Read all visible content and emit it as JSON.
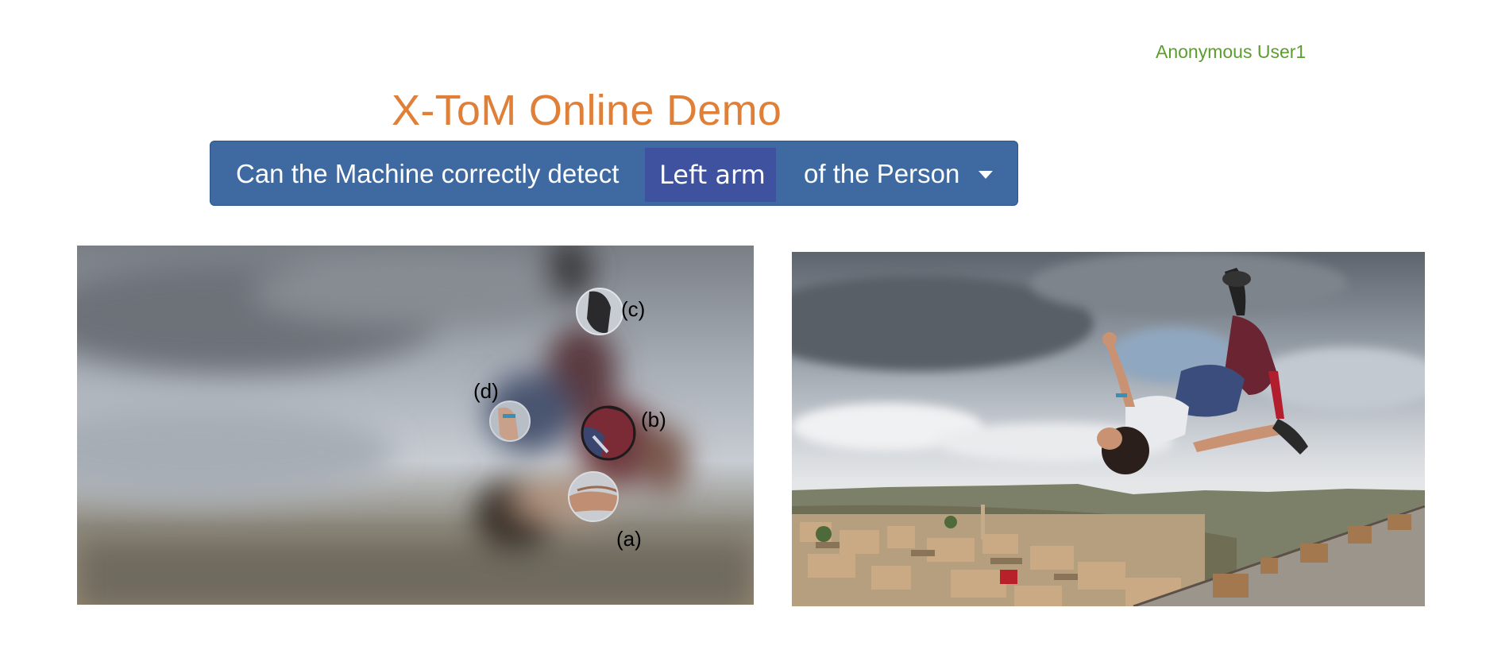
{
  "header": {
    "user_name": "Anonymous User1",
    "title": "X-ToM Online Demo"
  },
  "question": {
    "prefix": "Can the Machine correctly detect",
    "selected_part": "Left arm",
    "suffix": "of the Person"
  },
  "left_image": {
    "labels": [
      "(a)",
      "(b)",
      "(c)",
      "(d)"
    ]
  },
  "colors": {
    "title": "#df7f38",
    "user": "#5c9e2e",
    "question_bg": "#3e6aa1",
    "selected_bg": "#3f52a0"
  },
  "icons": {
    "dropdown": "caret-down-icon"
  }
}
